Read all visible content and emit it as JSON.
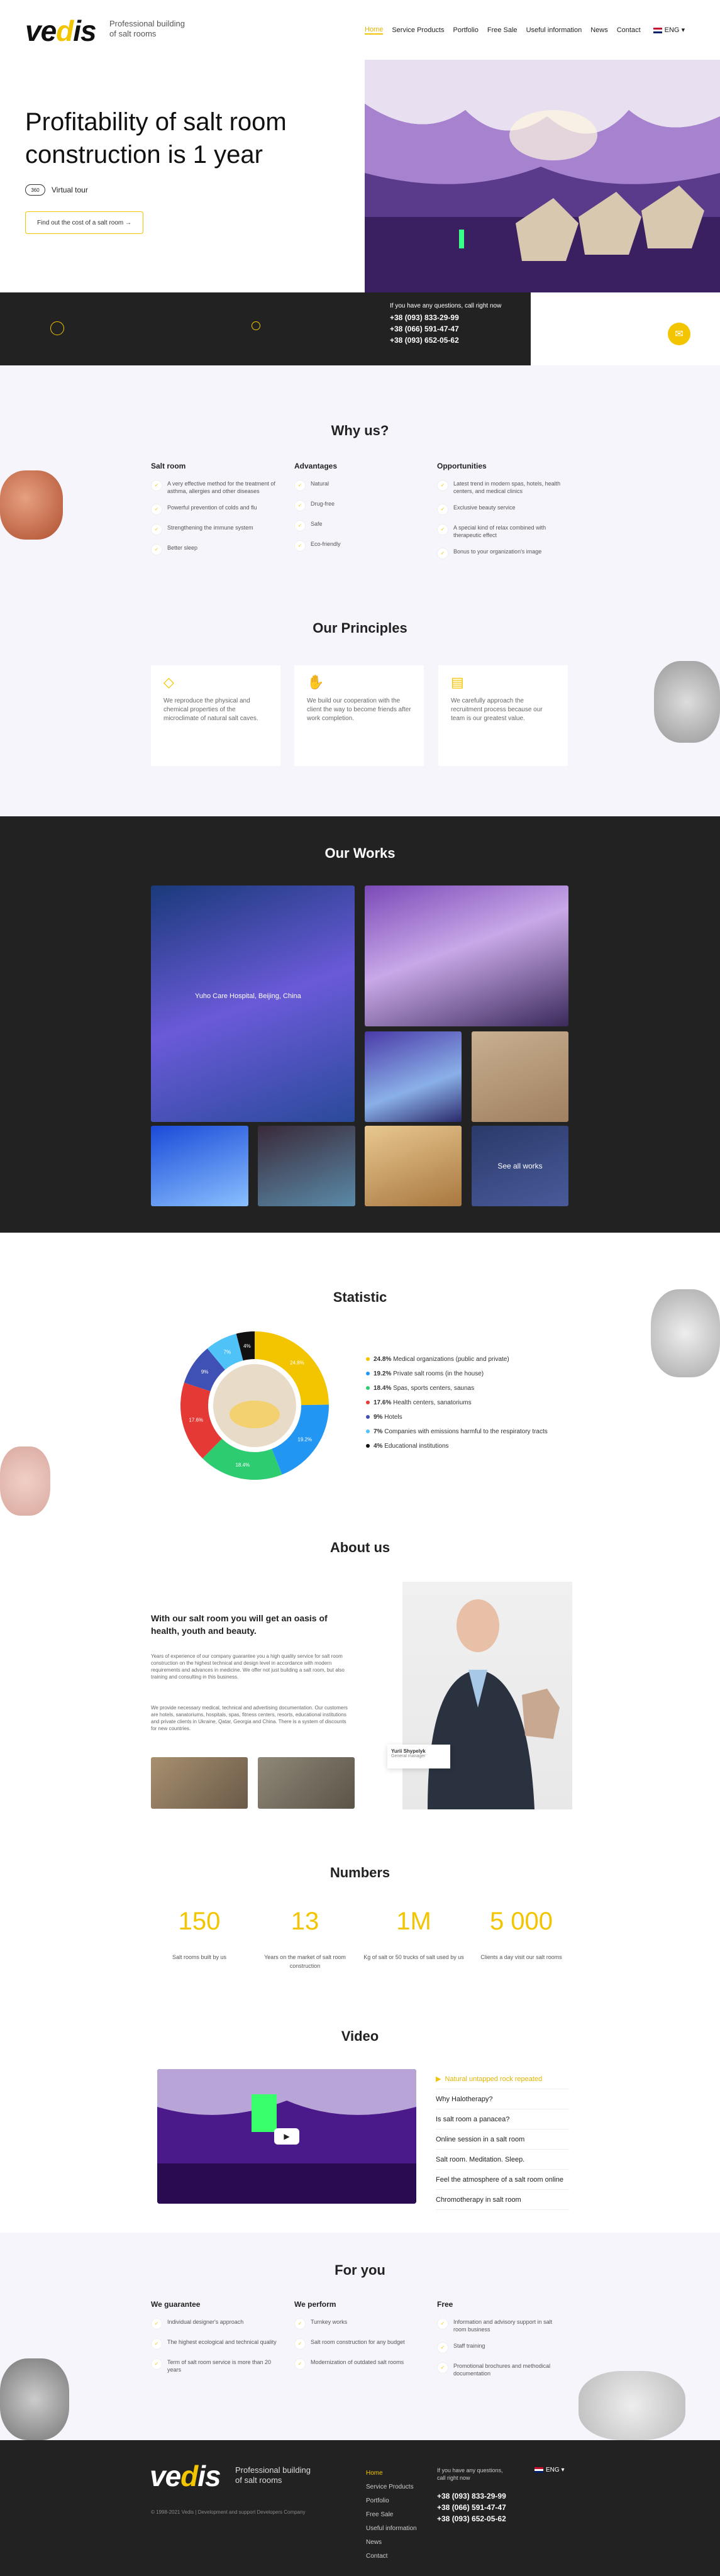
{
  "header": {
    "logo_main": "ve",
    "logo_accent": "d",
    "logo_end": "is",
    "tagline": "Professional building of salt rooms",
    "nav": [
      "Home",
      "Service Products",
      "Portfolio",
      "Free Sale",
      "Useful information",
      "News",
      "Contact"
    ],
    "lang": "ENG"
  },
  "hero": {
    "title": "Profitability of salt room construction is 1 year",
    "vt_icon": "360",
    "virtual_tour": "Virtual tour",
    "cta": "Find out the cost of a salt room",
    "contact_label": "If you have any questions, call right now",
    "phones": [
      "+38 (093) 833-29-99",
      "+38 (066) 591-47-47",
      "+38 (093) 652-05-62"
    ]
  },
  "why": {
    "title": "Why us?",
    "cols": [
      {
        "title": "Salt room",
        "items": [
          "A very effective method for the treatment of asthma, allergies and other diseases",
          "Powerful prevention of colds and flu",
          "Strengthening the immune system",
          "Better sleep"
        ]
      },
      {
        "title": "Advantages",
        "items": [
          "Natural",
          "Drug-free",
          "Safe",
          "Eco-friendly"
        ]
      },
      {
        "title": "Opportunities",
        "items": [
          "Latest trend in modern spas, hotels, health centers, and medical clinics",
          "Exclusive beauty service",
          "A special kind of relax combined with therapeutic effect",
          "Bonus to your organization's image"
        ]
      }
    ]
  },
  "principles": {
    "title": "Our Principles",
    "cards": [
      {
        "icon": "crystal-icon",
        "text": "We reproduce the physical and chemical properties of the microclimate of natural salt caves."
      },
      {
        "icon": "handshake-icon",
        "text": "We build our cooperation with the client the way to become friends after work completion."
      },
      {
        "icon": "document-icon",
        "text": "We carefully approach the recruitment process because our team is our greatest value."
      }
    ]
  },
  "works": {
    "title": "Our Works",
    "caption": "Yuho Care Hospital, Beijing, China",
    "see_all": "See all works"
  },
  "statistic": {
    "title": "Statistic",
    "items": [
      {
        "pct": "24.8%",
        "label": "Medical organizations (public and private)",
        "color": "#f3c500"
      },
      {
        "pct": "19.2%",
        "label": "Private salt rooms (in the house)",
        "color": "#2196f3"
      },
      {
        "pct": "18.4%",
        "label": "Spas, sports centers, saunas",
        "color": "#2ecc71"
      },
      {
        "pct": "17.6%",
        "label": "Health centers, sanatoriums",
        "color": "#e53935"
      },
      {
        "pct": "9%",
        "label": "Hotels",
        "color": "#3f51b5"
      },
      {
        "pct": "7%",
        "label": "Companies with emissions harmful to the respiratory tracts",
        "color": "#4fc3f7"
      },
      {
        "pct": "4%",
        "label": "Educational institutions",
        "color": "#111111"
      }
    ]
  },
  "chart_data": {
    "type": "pie",
    "categories": [
      "Medical organizations (public and private)",
      "Private salt rooms (in the house)",
      "Spas, sports centers, saunas",
      "Health centers, sanatoriums",
      "Hotels",
      "Companies with emissions harmful to the respiratory tracts",
      "Educational institutions"
    ],
    "values": [
      24.8,
      19.2,
      18.4,
      17.6,
      9,
      7,
      4
    ],
    "title": "Statistic"
  },
  "about": {
    "title": "About us",
    "heading": "With our salt room you will get an oasis of health, youth and beauty.",
    "p1": "Years of experience of our company guarantee you a high quality service for salt room construction on the highest technical and design level in accordance with modern requirements and advances in medicine. We offer not just building a salt room, but also training and consulting in this business.",
    "p2": "We provide necessary medical, technical and advertising documentation. Our customers are hotels, sanatoriums, hospitals, spas, fitness centers, resorts, educational institutions and private clients in Ukraine, Qatar, Georgia and China. There is a system of discounts for new countries.",
    "person_name": "Yurii Shypelyk",
    "person_role": "General manager"
  },
  "numbers": {
    "title": "Numbers",
    "items": [
      {
        "value": "150",
        "label": "Salt rooms built by us"
      },
      {
        "value": "13",
        "label": "Years on the market of salt room construction"
      },
      {
        "value": "1M",
        "label": "Kg of salt or 50 trucks of salt used by us"
      },
      {
        "value": "5 000",
        "label": "Clients a day visit our salt rooms"
      }
    ]
  },
  "video": {
    "title": "Video",
    "items": [
      "Natural untapped rock repeated",
      "Why Halotherapy?",
      "Is salt room a panacea?",
      "Online session in a salt room",
      "Salt room. Meditation. Sleep.",
      "Feel the atmosphere of a salt room online",
      "Chromotherapy in salt room"
    ]
  },
  "foryou": {
    "title": "For you",
    "cols": [
      {
        "title": "We guarantee",
        "items": [
          "Individual designer's approach",
          "The highest ecological and technical quality",
          "Term of salt room service is more than 20 years"
        ]
      },
      {
        "title": "We perform",
        "items": [
          "Turnkey works",
          "Salt room construction for any budget",
          "Modernization of outdated salt rooms"
        ]
      },
      {
        "title": "Free",
        "items": [
          "Information and advisory support in salt room business",
          "Staff training",
          "Promotional brochures and methodical documentation"
        ]
      }
    ]
  },
  "footer": {
    "tagline": "Professional building of salt rooms",
    "copyright": "© 1998-2021 Vedis  |  Development and support Developers Company",
    "nav": [
      "Home",
      "Service Products",
      "Portfolio",
      "Free Sale",
      "Useful information",
      "News",
      "Contact"
    ],
    "contact_label": "If you have any questions, call right now",
    "phones": [
      "+38 (093) 833-29-99",
      "+38 (066) 591-47-47",
      "+38 (093) 652-05-62"
    ],
    "lang": "ENG"
  }
}
